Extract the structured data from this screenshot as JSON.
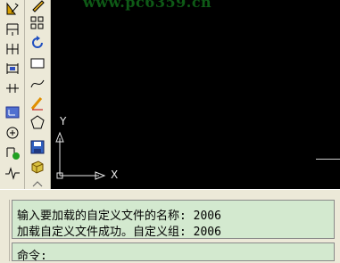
{
  "canvas": {
    "watermark": "www.pc6359.cn",
    "ucs_labels": {
      "y": "Y",
      "x": "X"
    }
  },
  "toolbar_left": [
    {
      "icon": "cursor-icon"
    },
    {
      "icon": "dim-linear-icon"
    },
    {
      "icon": "dim-aligned-icon"
    },
    {
      "icon": "dim-baseline-icon"
    },
    {
      "icon": "dim-continue-icon"
    },
    {
      "icon": "ucs-icon"
    },
    {
      "icon": "center-mark-icon"
    },
    {
      "icon": "dim-update-icon"
    },
    {
      "icon": "jog-line-icon"
    }
  ],
  "toolbar_right": [
    {
      "icon": "pencil-icon"
    },
    {
      "icon": "array-icon"
    },
    {
      "icon": "rotate-icon"
    },
    {
      "icon": "rectangle-icon"
    },
    {
      "icon": "spline-icon"
    },
    {
      "icon": "edit-icon"
    },
    {
      "icon": "pentagon-icon"
    },
    {
      "icon": "save-icon"
    },
    {
      "icon": "insert-block-icon"
    }
  ],
  "command": {
    "history": [
      "输入要加载的自定义文件的名称: 2006",
      "加载自定义文件成功。自定义组: 2006"
    ],
    "prompt": "命令:"
  },
  "colors": {
    "canvas_bg": "#000000",
    "command_bg": "#d3e9cf",
    "chrome": "#ece9d8"
  }
}
